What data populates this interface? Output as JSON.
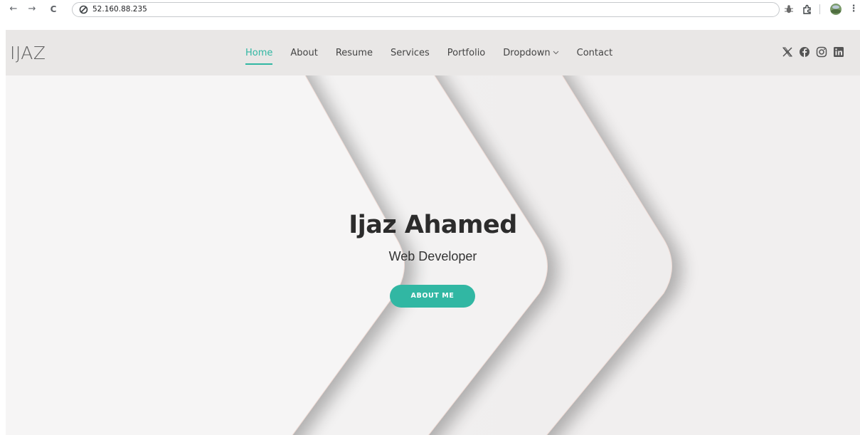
{
  "browser": {
    "url": "52.160.88.235",
    "back_glyph": "←",
    "forward_glyph": "→",
    "reload_glyph": "C",
    "menu_glyph": "⋮"
  },
  "site": {
    "logo": "IJAZ",
    "nav": [
      {
        "label": "Home",
        "active": true
      },
      {
        "label": "About"
      },
      {
        "label": "Resume"
      },
      {
        "label": "Services"
      },
      {
        "label": "Portfolio"
      },
      {
        "label": "Dropdown"
      },
      {
        "label": "Contact"
      }
    ],
    "socials": [
      "x-icon",
      "facebook-icon",
      "instagram-icon",
      "linkedin-icon"
    ]
  },
  "hero": {
    "title": "Ijaz Ahamed",
    "subtitle": "Web Developer",
    "button_label": "ABOUT ME"
  },
  "colors": {
    "accent": "#31b7a3",
    "header_bg": "#e9e7e6",
    "hero_bg": "#f4f3f3",
    "text_dark": "#2c2c2c"
  }
}
